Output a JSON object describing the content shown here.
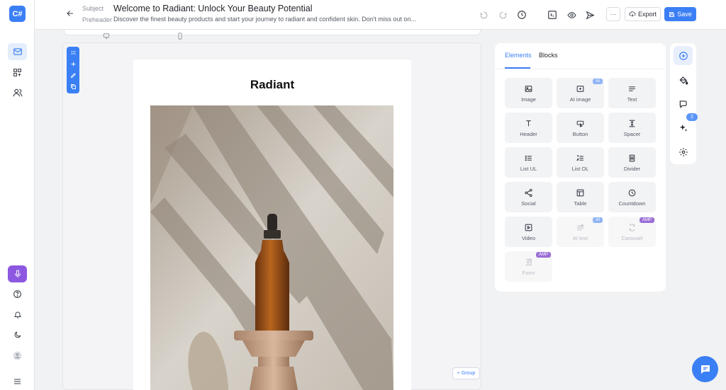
{
  "app": {
    "logo_text": "C#"
  },
  "leftnav": {
    "items": [
      {
        "name": "mail-icon",
        "active": true
      },
      {
        "name": "grid-add-icon",
        "active": false
      },
      {
        "name": "users-icon",
        "active": false
      }
    ],
    "bottom": [
      "podcast-icon",
      "help-icon",
      "bell-icon",
      "moon-icon",
      "avatar",
      "menu-icon"
    ]
  },
  "header": {
    "subject_label": "Subject",
    "subject_value": "Welcome to Radiant: Unlock Your Beauty Potential",
    "preheader_label": "Preheader",
    "preheader_value": "Discover the finest beauty products and start your journey to radiant and confident skin. Don't miss out on...",
    "more_label": "···",
    "export_label": "Export",
    "save_label": "Save"
  },
  "canvas": {
    "email_title": "Radiant",
    "group_button": "+ Group"
  },
  "panel": {
    "tabs": [
      "Elements",
      "Blocks"
    ],
    "active_tab": "Elements",
    "tiles": [
      {
        "label": "Image",
        "icon": "image-icon",
        "badge": "",
        "disabled": false
      },
      {
        "label": "AI image",
        "icon": "ai-image-icon",
        "badge": "AI",
        "disabled": false
      },
      {
        "label": "Text",
        "icon": "text-icon",
        "badge": "",
        "disabled": false
      },
      {
        "label": "Header",
        "icon": "header-icon",
        "badge": "",
        "disabled": false
      },
      {
        "label": "Button",
        "icon": "button-icon",
        "badge": "",
        "disabled": false
      },
      {
        "label": "Spacer",
        "icon": "spacer-icon",
        "badge": "",
        "disabled": false
      },
      {
        "label": "List UL",
        "icon": "list-ul-icon",
        "badge": "",
        "disabled": false
      },
      {
        "label": "List OL",
        "icon": "list-ol-icon",
        "badge": "",
        "disabled": false
      },
      {
        "label": "Divider",
        "icon": "divider-icon",
        "badge": "",
        "disabled": false
      },
      {
        "label": "Social",
        "icon": "share-icon",
        "badge": "",
        "disabled": false
      },
      {
        "label": "Table",
        "icon": "table-icon",
        "badge": "",
        "disabled": false
      },
      {
        "label": "Countdown",
        "icon": "clock-icon",
        "badge": "",
        "disabled": false
      },
      {
        "label": "Video",
        "icon": "video-icon",
        "badge": "",
        "disabled": false
      },
      {
        "label": "AI text",
        "icon": "ai-text-icon",
        "badge": "AI",
        "disabled": true
      },
      {
        "label": "Carousel",
        "icon": "carousel-icon",
        "badge": "AMP",
        "disabled": true
      },
      {
        "label": "Form",
        "icon": "form-icon",
        "badge": "AMP",
        "disabled": true
      }
    ]
  },
  "rail": {
    "items": [
      "plus-circle-icon",
      "paint-bucket-icon",
      "chat-icon",
      "sparkle-icon",
      "gear-icon"
    ],
    "badge_count": "2"
  },
  "colors": {
    "accent": "#3b7ff5",
    "ai_badge": "#8fb5f5",
    "amp_badge": "#9b6fd6",
    "podcast": "#8d58e0"
  }
}
